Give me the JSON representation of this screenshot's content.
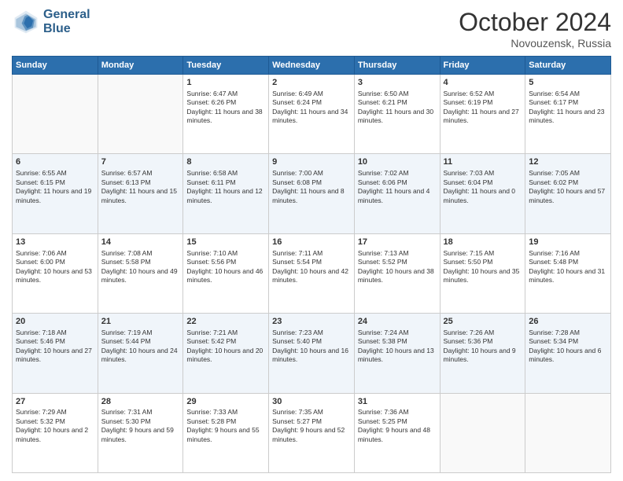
{
  "header": {
    "logo_line1": "General",
    "logo_line2": "Blue",
    "month": "October 2024",
    "location": "Novouzensk, Russia"
  },
  "days_of_week": [
    "Sunday",
    "Monday",
    "Tuesday",
    "Wednesday",
    "Thursday",
    "Friday",
    "Saturday"
  ],
  "weeks": [
    [
      {
        "day": "",
        "info": ""
      },
      {
        "day": "",
        "info": ""
      },
      {
        "day": "1",
        "info": "Sunrise: 6:47 AM\nSunset: 6:26 PM\nDaylight: 11 hours and 38 minutes."
      },
      {
        "day": "2",
        "info": "Sunrise: 6:49 AM\nSunset: 6:24 PM\nDaylight: 11 hours and 34 minutes."
      },
      {
        "day": "3",
        "info": "Sunrise: 6:50 AM\nSunset: 6:21 PM\nDaylight: 11 hours and 30 minutes."
      },
      {
        "day": "4",
        "info": "Sunrise: 6:52 AM\nSunset: 6:19 PM\nDaylight: 11 hours and 27 minutes."
      },
      {
        "day": "5",
        "info": "Sunrise: 6:54 AM\nSunset: 6:17 PM\nDaylight: 11 hours and 23 minutes."
      }
    ],
    [
      {
        "day": "6",
        "info": "Sunrise: 6:55 AM\nSunset: 6:15 PM\nDaylight: 11 hours and 19 minutes."
      },
      {
        "day": "7",
        "info": "Sunrise: 6:57 AM\nSunset: 6:13 PM\nDaylight: 11 hours and 15 minutes."
      },
      {
        "day": "8",
        "info": "Sunrise: 6:58 AM\nSunset: 6:11 PM\nDaylight: 11 hours and 12 minutes."
      },
      {
        "day": "9",
        "info": "Sunrise: 7:00 AM\nSunset: 6:08 PM\nDaylight: 11 hours and 8 minutes."
      },
      {
        "day": "10",
        "info": "Sunrise: 7:02 AM\nSunset: 6:06 PM\nDaylight: 11 hours and 4 minutes."
      },
      {
        "day": "11",
        "info": "Sunrise: 7:03 AM\nSunset: 6:04 PM\nDaylight: 11 hours and 0 minutes."
      },
      {
        "day": "12",
        "info": "Sunrise: 7:05 AM\nSunset: 6:02 PM\nDaylight: 10 hours and 57 minutes."
      }
    ],
    [
      {
        "day": "13",
        "info": "Sunrise: 7:06 AM\nSunset: 6:00 PM\nDaylight: 10 hours and 53 minutes."
      },
      {
        "day": "14",
        "info": "Sunrise: 7:08 AM\nSunset: 5:58 PM\nDaylight: 10 hours and 49 minutes."
      },
      {
        "day": "15",
        "info": "Sunrise: 7:10 AM\nSunset: 5:56 PM\nDaylight: 10 hours and 46 minutes."
      },
      {
        "day": "16",
        "info": "Sunrise: 7:11 AM\nSunset: 5:54 PM\nDaylight: 10 hours and 42 minutes."
      },
      {
        "day": "17",
        "info": "Sunrise: 7:13 AM\nSunset: 5:52 PM\nDaylight: 10 hours and 38 minutes."
      },
      {
        "day": "18",
        "info": "Sunrise: 7:15 AM\nSunset: 5:50 PM\nDaylight: 10 hours and 35 minutes."
      },
      {
        "day": "19",
        "info": "Sunrise: 7:16 AM\nSunset: 5:48 PM\nDaylight: 10 hours and 31 minutes."
      }
    ],
    [
      {
        "day": "20",
        "info": "Sunrise: 7:18 AM\nSunset: 5:46 PM\nDaylight: 10 hours and 27 minutes."
      },
      {
        "day": "21",
        "info": "Sunrise: 7:19 AM\nSunset: 5:44 PM\nDaylight: 10 hours and 24 minutes."
      },
      {
        "day": "22",
        "info": "Sunrise: 7:21 AM\nSunset: 5:42 PM\nDaylight: 10 hours and 20 minutes."
      },
      {
        "day": "23",
        "info": "Sunrise: 7:23 AM\nSunset: 5:40 PM\nDaylight: 10 hours and 16 minutes."
      },
      {
        "day": "24",
        "info": "Sunrise: 7:24 AM\nSunset: 5:38 PM\nDaylight: 10 hours and 13 minutes."
      },
      {
        "day": "25",
        "info": "Sunrise: 7:26 AM\nSunset: 5:36 PM\nDaylight: 10 hours and 9 minutes."
      },
      {
        "day": "26",
        "info": "Sunrise: 7:28 AM\nSunset: 5:34 PM\nDaylight: 10 hours and 6 minutes."
      }
    ],
    [
      {
        "day": "27",
        "info": "Sunrise: 7:29 AM\nSunset: 5:32 PM\nDaylight: 10 hours and 2 minutes."
      },
      {
        "day": "28",
        "info": "Sunrise: 7:31 AM\nSunset: 5:30 PM\nDaylight: 9 hours and 59 minutes."
      },
      {
        "day": "29",
        "info": "Sunrise: 7:33 AM\nSunset: 5:28 PM\nDaylight: 9 hours and 55 minutes."
      },
      {
        "day": "30",
        "info": "Sunrise: 7:35 AM\nSunset: 5:27 PM\nDaylight: 9 hours and 52 minutes."
      },
      {
        "day": "31",
        "info": "Sunrise: 7:36 AM\nSunset: 5:25 PM\nDaylight: 9 hours and 48 minutes."
      },
      {
        "day": "",
        "info": ""
      },
      {
        "day": "",
        "info": ""
      }
    ]
  ]
}
